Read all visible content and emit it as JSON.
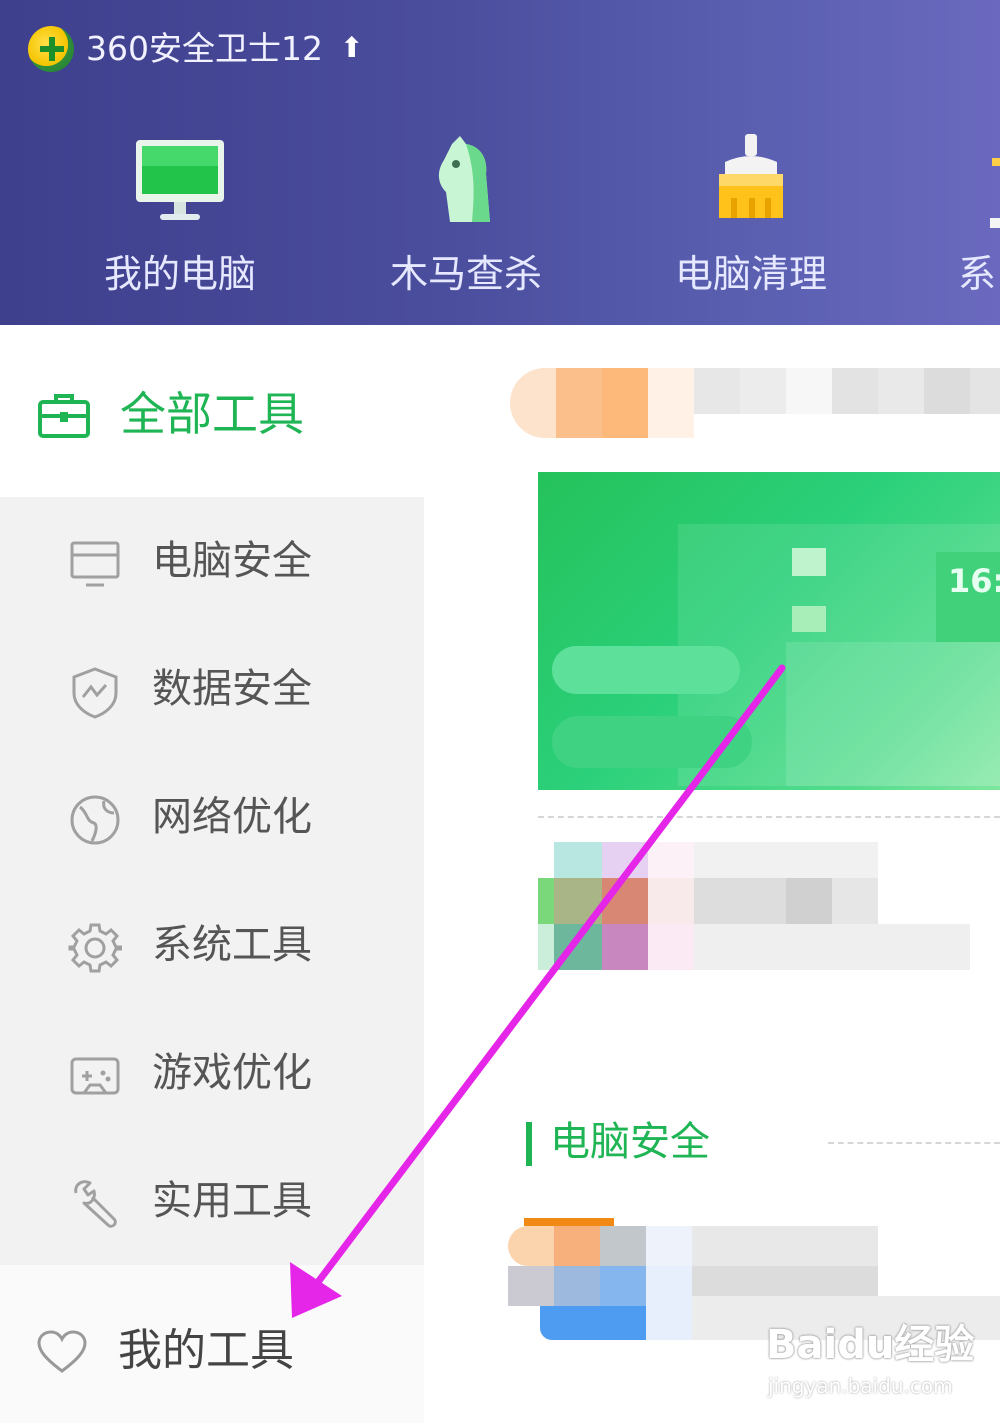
{
  "header": {
    "app_title": "360安全卫士12",
    "upgrade_icon": "up-arrow-icon",
    "nav": [
      {
        "label": "我的电脑",
        "icon": "monitor-icon"
      },
      {
        "label": "木马查杀",
        "icon": "horse-icon"
      },
      {
        "label": "电脑清理",
        "icon": "broom-icon"
      },
      {
        "label": "系",
        "icon": "system-icon"
      }
    ]
  },
  "sidebar": {
    "all_tools": {
      "label": "全部工具",
      "icon": "toolbox-icon"
    },
    "items": [
      {
        "label": "电脑安全",
        "icon": "monitor-outline-icon"
      },
      {
        "label": "数据安全",
        "icon": "shield-icon"
      },
      {
        "label": "网络优化",
        "icon": "globe-icon"
      },
      {
        "label": "系统工具",
        "icon": "gear-icon"
      },
      {
        "label": "游戏优化",
        "icon": "gamepad-icon"
      },
      {
        "label": "实用工具",
        "icon": "wrench-icon"
      }
    ],
    "my_tools": {
      "label": "我的工具",
      "icon": "heart-icon"
    }
  },
  "main": {
    "banner_clock": "16:",
    "section_title": "电脑安全"
  },
  "watermark": {
    "brand": "Baidu经验",
    "url": "jingyan.baidu.com"
  },
  "colors": {
    "header_start": "#3e3f8d",
    "header_end": "#6a69bf",
    "accent_green": "#1fb554",
    "arrow_magenta": "#e526e8"
  }
}
